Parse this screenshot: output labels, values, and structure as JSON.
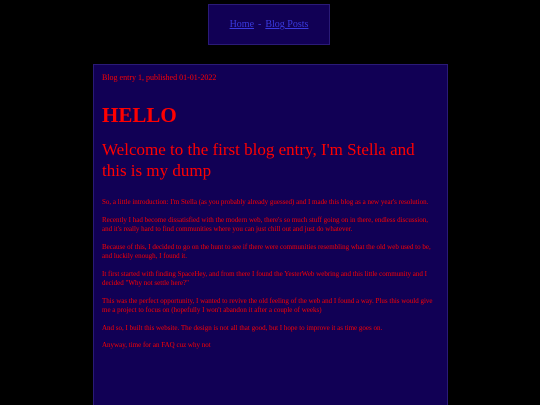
{
  "nav": {
    "links": [
      "Home",
      "Blog Posts"
    ],
    "separator": "-"
  },
  "post": {
    "meta": "Blog entry 1, published 01-01-2022",
    "heading": "HELLO",
    "subheading": "Welcome to the first blog entry, I'm Stella and this is my dump",
    "paragraphs": [
      "So, a little introduction: I'm Stella (as you probably already guessed) and I made this blog as a new year's resolution.",
      "Recently I had become dissatisfied with the modern web, there's so much stuff going on in there, endless discussion, and it's really hard to find communities where you can just chill out and just do whatever.",
      "Because of this, I decided to go on the hunt to see if there were communities resembling what the old web used to be, and luckily enough, I found it.",
      "It first started with finding SpaceHey, and from there I found the YesterWeb webring and this little community and I decided \"Why not settle here?\"",
      "This was the perfect opportunity, I wanted to revive the old feeling of the web and I found a way. Plus this would give me a project to focus on (hopefully I won't abandon it after a couple of weeks)",
      "And so, I built this website. The design is not all that good, but I hope to improve it as time goes on.",
      "Anyway, time for an FAQ cuz why not"
    ]
  },
  "colors": {
    "background": "#000000",
    "panel": "#110055",
    "text": "#ff0000",
    "link": "#3a3ae0"
  }
}
